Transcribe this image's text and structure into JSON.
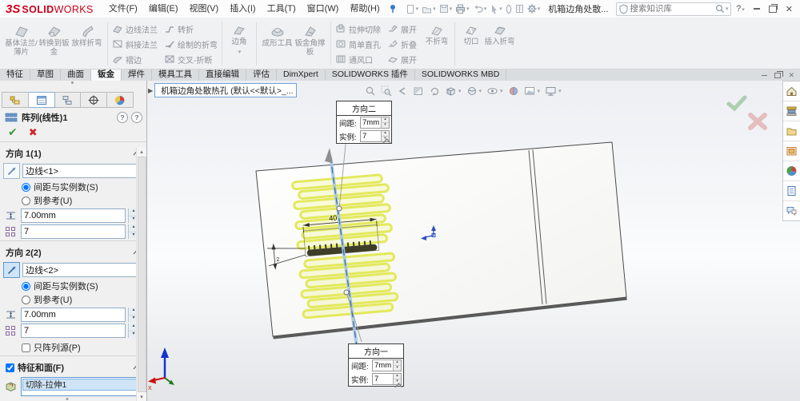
{
  "window": {
    "logo_mark": "3S",
    "logo_solid": "SOLID",
    "logo_works": "WORKS",
    "menus": [
      "文件(F)",
      "编辑(E)",
      "视图(V)",
      "插入(I)",
      "工具(T)",
      "窗口(W)",
      "帮助(H)"
    ],
    "doc_title_truncated": "机箱边角处散...",
    "search_placeholder": "搜索知识库",
    "help_glyph": "?",
    "quick_icons": [
      "new-document",
      "open-document",
      "save",
      "print",
      "undo",
      "select",
      "attachments",
      "view-list",
      "options-gear"
    ]
  },
  "ribbon": {
    "groups": [
      {
        "buttons": [
          "基体法兰/薄片",
          "转换到钣金",
          "放样折弯"
        ]
      },
      {
        "buttons": [
          "边线法兰",
          "斜接法兰",
          "褶边",
          "转折",
          "绘制的折弯",
          "交叉-折断"
        ]
      },
      {
        "buttons": [
          "边角"
        ]
      },
      {
        "buttons": [
          "成形工具",
          "钣金角撑板"
        ]
      },
      {
        "buttons": [
          "拉伸切除",
          "简单直孔",
          "通风口"
        ]
      },
      {
        "buttons": [
          "展开",
          "折叠",
          "展开"
        ]
      },
      {
        "buttons": [
          "不折弯"
        ]
      },
      {
        "buttons": [
          "切口",
          "插入折弯"
        ]
      }
    ]
  },
  "tabs": {
    "items": [
      "特征",
      "草图",
      "曲面",
      "钣金",
      "焊件",
      "模具工具",
      "直接编辑",
      "评估",
      "DimXpert",
      "SOLIDWORKS 插件",
      "SOLIDWORKS MBD"
    ],
    "active": "钣金"
  },
  "property_panel": {
    "title": "阵列(线性)1",
    "manager_tabs": [
      "feature-manager",
      "property-manager",
      "configuration-manager",
      "dimxpert-manager",
      "display-manager"
    ],
    "direction1": {
      "header": "方向 1(1)",
      "edge_value": "边线<1>",
      "radio_spacing_instances": "间距与实例数(S)",
      "radio_up_to_reference": "到参考(U)",
      "spacing_value": "7.00mm",
      "instances_value": "7"
    },
    "direction2": {
      "header": "方向 2(2)",
      "edge_value": "边线<2>",
      "radio_spacing_instances": "间距与实例数(S)",
      "radio_up_to_reference": "到参考(U)",
      "spacing_value": "7.00mm",
      "instances_value": "7",
      "pattern_seed_only": "只阵列源(P)"
    },
    "features_faces": {
      "header": "特征和面(F)",
      "selected_feature": "切除-拉伸1"
    }
  },
  "viewport": {
    "feature_tree_label": "机箱边角处散热孔 (默认<<默认>_...",
    "hud_icons": [
      "zoom-fit",
      "zoom-area",
      "previous-view",
      "section-view",
      "rotate-view",
      "view-orientation",
      "display-style",
      "hide-show-items",
      "edit-appearance",
      "apply-scene",
      "view-settings"
    ],
    "callout_direction2": {
      "title": "方向二",
      "spacing_label": "间距:",
      "spacing_value": "7mm",
      "instances_label": "实例:",
      "instances_value": "7"
    },
    "callout_direction1": {
      "title": "方向一",
      "spacing_label": "间距:",
      "spacing_value": "7mm",
      "instances_label": "实例:",
      "instances_value": "7"
    },
    "dimension_width": "40",
    "dimension_pitch": "2",
    "triad_axis_label": "X"
  },
  "task_pane_icons": [
    "solidworks-resources",
    "design-library",
    "file-explorer",
    "view-palette",
    "appearances-scenes",
    "custom-properties",
    "solidworks-forum"
  ],
  "colors": {
    "logo_red": "#c9001a",
    "pattern_preview_yellow": "#e8ee62",
    "seed_feature_dark": "#3e3e28",
    "axis_highlight_blue": "#a6c6e6",
    "selection_fill_blue": "#cfe4f7",
    "confirm_green": "#6fae6f",
    "cancel_red": "#d98c8c"
  }
}
